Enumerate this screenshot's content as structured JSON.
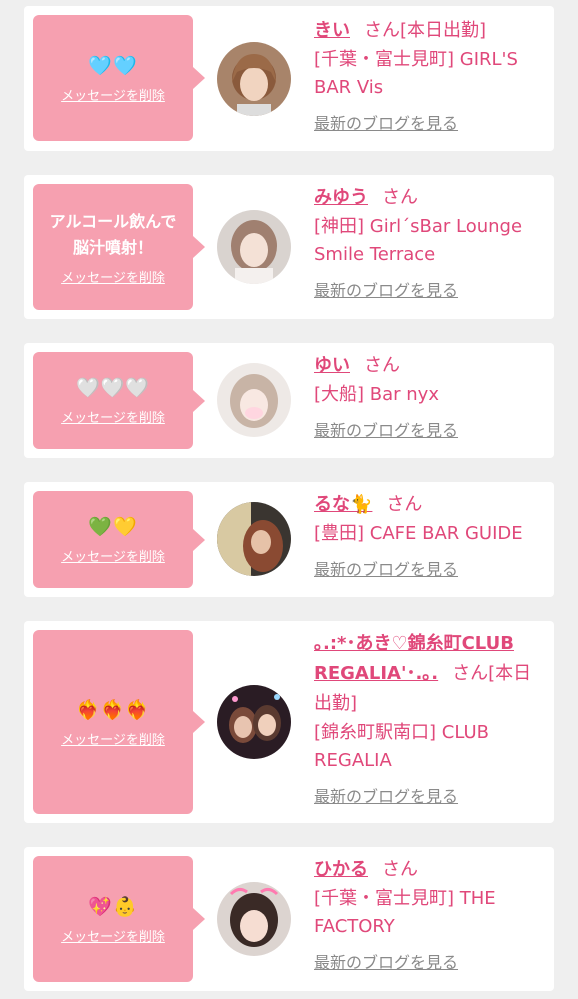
{
  "cards": [
    {
      "message": "🩵🩵",
      "delete_label": "メッセージを削除",
      "name": "きい",
      "honorific": "さん[本日出勤]",
      "shop": "[千葉・富士見町] GIRL'S BAR Vis",
      "blog_label": "最新のブログを見る"
    },
    {
      "message": "アルコール飲んで\n脳汁噴射！",
      "delete_label": "メッセージを削除",
      "name": "みゆう",
      "honorific": "さん",
      "shop": "[神田] Girl´sBar Lounge Smile Terrace",
      "blog_label": "最新のブログを見る"
    },
    {
      "message": "🤍🤍🤍",
      "delete_label": "メッセージを削除",
      "name": "ゆい",
      "honorific": "さん",
      "shop": "[大船] Bar nyx",
      "blog_label": "最新のブログを見る"
    },
    {
      "message": "💚💛",
      "delete_label": "メッセージを削除",
      "name": "るな🐈",
      "honorific": "さん",
      "shop": "[豊田] CAFE BAR GUIDE",
      "blog_label": "最新のブログを見る"
    },
    {
      "message": "❤️‍🔥❤️‍🔥❤️‍🔥",
      "delete_label": "メッセージを削除",
      "name": "｡.:*･あき♡錦糸町CLUB REGALIA'･.｡.",
      "honorific": "さん[本日出勤]",
      "shop": "[錦糸町駅南口] CLUB REGALIA",
      "blog_label": "最新のブログを見る"
    },
    {
      "message": "💖👶",
      "delete_label": "メッセージを削除",
      "name": "ひかる",
      "honorific": "さん",
      "shop": "[千葉・富士見町] THE FACTORY",
      "blog_label": "最新のブログを見る"
    }
  ],
  "colors": {
    "accent": "#e0487a",
    "bubble": "#f6a0b0",
    "link_gray": "#8a8a8a",
    "background": "#efefef"
  }
}
